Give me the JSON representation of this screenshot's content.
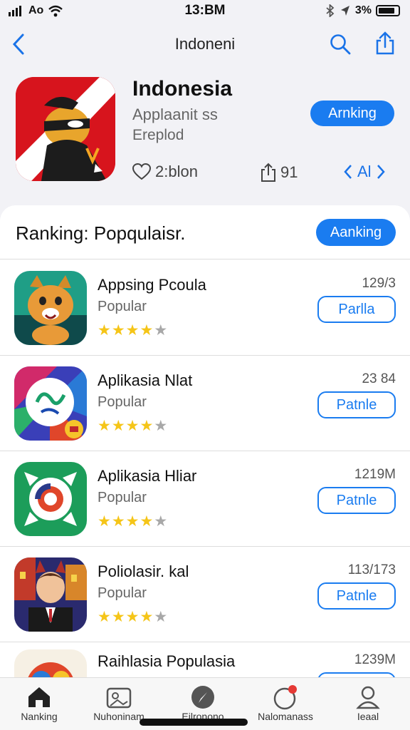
{
  "status": {
    "carrier": "Ao",
    "time": "13:BM",
    "battery": "3%"
  },
  "nav": {
    "title": "Indoneni"
  },
  "app": {
    "name": "Indonesia",
    "subtitle": "Applaanit ss",
    "subtitle2": "Ereplod",
    "button": "Arnking",
    "likes": "2:blon",
    "shares": "91",
    "pager": "Al"
  },
  "section": {
    "title": "Ranking: Popqulaisr.",
    "button": "Aanking"
  },
  "list": [
    {
      "name": "Appsing Pcoula",
      "category": "Popular",
      "count": "129/3",
      "button": "Parlla",
      "rating": 4
    },
    {
      "name": "Aplikasia Nlat",
      "category": "Popular",
      "count": "23 84",
      "button": "Patnle",
      "rating": 4.5
    },
    {
      "name": "Aplikasia Hliar",
      "category": "Popular",
      "count": "1219M",
      "button": "Patnle",
      "rating": 4.5
    },
    {
      "name": "Poliolasir. kal",
      "category": "Popular",
      "count": "113/173",
      "button": "Patnle",
      "rating": 4
    },
    {
      "name": "Raihlasia Populasia",
      "category": "",
      "count": "1239M",
      "button": "",
      "rating": 0
    }
  ],
  "tabs": [
    {
      "label": "Nanking",
      "icon": "home-icon"
    },
    {
      "label": "Nuhoninam",
      "icon": "photo-icon"
    },
    {
      "label": "Eilronono",
      "icon": "compass-icon"
    },
    {
      "label": "Nalomanass",
      "icon": "notification-icon"
    },
    {
      "label": "Ieaal",
      "icon": "profile-icon"
    }
  ],
  "colors": {
    "accent": "#1a7cf0",
    "star": "#f5c518",
    "brand_red": "#d7141d"
  }
}
